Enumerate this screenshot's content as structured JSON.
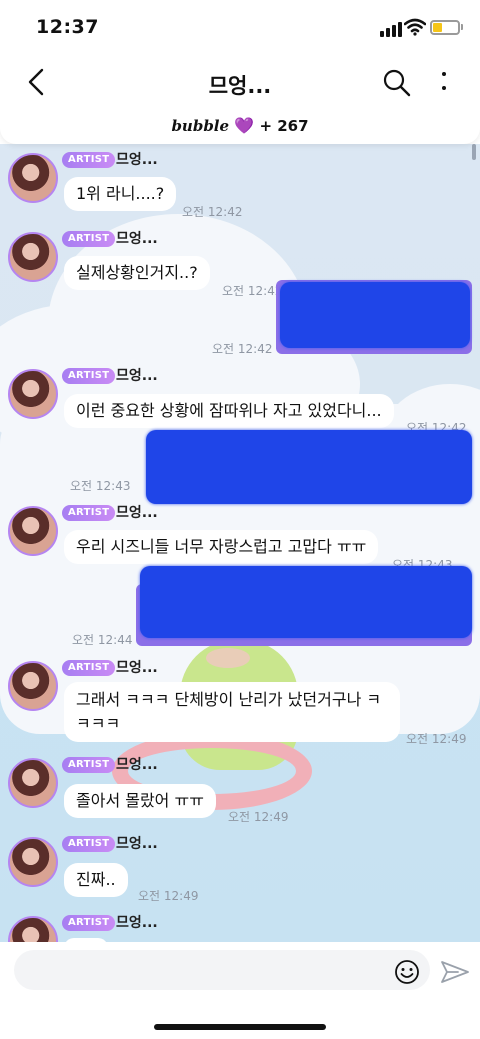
{
  "status": {
    "time": "12:37"
  },
  "header": {
    "title": "므엉...",
    "bubble_logo": "bubble",
    "heart": "💜",
    "count": "+ 267"
  },
  "badge_label": "ARTIST",
  "sender": "므엉...",
  "messages": [
    {
      "text": "1위 라니....?",
      "time": "오전 12:42"
    },
    {
      "text": "실제상황인거지..?",
      "time": "오전 12:42"
    },
    {
      "text": "이런 중요한 상황에 잠따위나 자고 있었다니...",
      "time": "오전 12:42"
    },
    {
      "text": "우리 시즈니들 너무 자랑스럽고 고맙다 ㅠㅠ",
      "time": "오전 12:43"
    },
    {
      "text": "그래서 ㅋㅋㅋ 단체방이 난리가 났던거구나 ㅋㅋㅋㅋ",
      "time": "오전 12:49"
    },
    {
      "text": "졸아서 몰랐어 ㅠㅠ",
      "time": "오전 12:49"
    },
    {
      "text": "진짜..",
      "time": "오전 12:49"
    }
  ],
  "fan_times": [
    "오전 12:42",
    "오전 12:43",
    "오전 12:44"
  ],
  "icons": [
    "back-arrow-icon",
    "search-icon",
    "more-vertical-icon",
    "emoji-icon",
    "send-icon"
  ],
  "colors": {
    "artist_badge": "#b07ff2",
    "scribble": "#1f45e8",
    "chat_bg": "#dbe7f3"
  }
}
